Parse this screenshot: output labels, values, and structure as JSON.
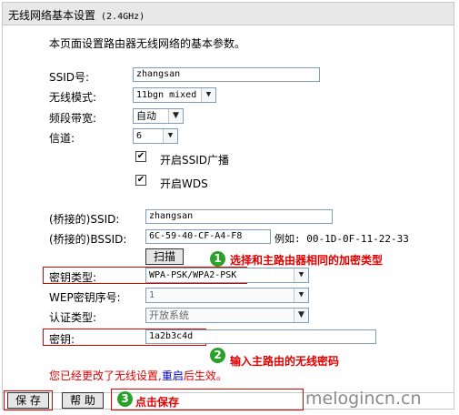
{
  "header": {
    "title": "无线网络基本设置",
    "frequency": "(2.4GHz)"
  },
  "intro": "本页面设置路由器无线网络的基本参数。",
  "fields": {
    "ssid": {
      "label": "SSID号:",
      "value": "zhangsan"
    },
    "mode": {
      "label": "无线模式:",
      "value": "11bgn mixed"
    },
    "bandwidth": {
      "label": "频段带宽:",
      "value": "自动"
    },
    "channel": {
      "label": "信道:",
      "value": "6"
    },
    "ssid_broadcast": {
      "label": "开启SSID广播",
      "checked": true
    },
    "wds": {
      "label": "开启WDS",
      "checked": true
    },
    "bridge_ssid": {
      "label": "(桥接的)SSID:",
      "value": "zhangsan"
    },
    "bridge_bssid": {
      "label": "(桥接的)BSSID:",
      "value": "6C-59-40-CF-A4-F8",
      "example": "例如: 00-1D-0F-11-22-33"
    },
    "scan_button": "扫描",
    "key_type": {
      "label": "密钥类型:",
      "value": "WPA-PSK/WPA2-PSK"
    },
    "wep_index": {
      "label": "WEP密钥序号:",
      "value": "1"
    },
    "auth_type": {
      "label": "认证类型:",
      "value": "开放系统"
    },
    "key": {
      "label": "密钥:",
      "value": "1a2b3c4d"
    }
  },
  "notice": {
    "text": "您已经更改了无线设置,",
    "link": "重启",
    "suffix": "后生效。"
  },
  "buttons": {
    "save": "保 存",
    "help": "帮 助"
  },
  "annotations": [
    {
      "number": "1",
      "text": "选择和主路由器相同的加密类型"
    },
    {
      "number": "2",
      "text": "输入主路由的无线密码"
    },
    {
      "number": "3",
      "text": "点击保存"
    }
  ],
  "watermark": "melogincn.cn",
  "icons": {
    "dropdown": "chevron-down-icon",
    "checkmark": "check-icon"
  },
  "colors": {
    "annotation_red": "#e00000",
    "badge_green": "#2aa12a",
    "link_blue": "#0000cc"
  }
}
